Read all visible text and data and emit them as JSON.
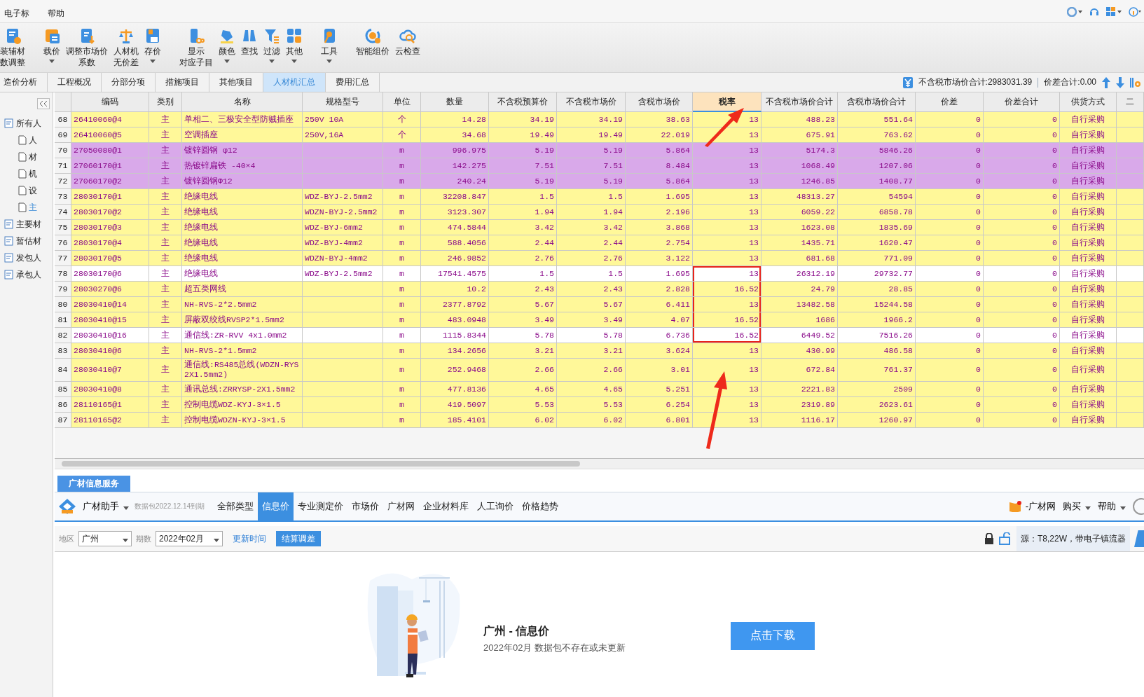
{
  "menu": [
    "电子标",
    "帮助"
  ],
  "toolbar": [
    {
      "lines": [
        "装辅材",
        "数调整"
      ],
      "has_menu": false
    },
    {
      "lines": [
        "载价"
      ],
      "has_menu": true
    },
    {
      "lines": [
        "调整市场价",
        "系数"
      ],
      "has_menu": false
    },
    {
      "lines": [
        "人材机",
        "无价差"
      ],
      "has_menu": false
    },
    {
      "lines": [
        "存价"
      ],
      "has_menu": true
    },
    {
      "lines": [
        "显示",
        "对应子目"
      ],
      "has_menu": false
    },
    {
      "lines": [
        "颜色"
      ],
      "has_menu": true
    },
    {
      "lines": [
        "查找"
      ],
      "has_menu": false
    },
    {
      "lines": [
        "过滤"
      ],
      "has_menu": true
    },
    {
      "lines": [
        "其他"
      ],
      "has_menu": true
    },
    {
      "lines": [
        "工具"
      ],
      "has_menu": true
    },
    {
      "lines": [
        "智能组价"
      ],
      "has_menu": false
    },
    {
      "lines": [
        "云检查"
      ],
      "has_menu": false
    }
  ],
  "tabs": [
    {
      "label": "造价分析",
      "selected": false
    },
    {
      "label": "工程概况",
      "selected": false
    },
    {
      "label": "分部分项",
      "selected": false
    },
    {
      "label": "措施项目",
      "selected": false
    },
    {
      "label": "其他项目",
      "selected": false
    },
    {
      "label": "人材机汇总",
      "selected": true
    },
    {
      "label": "费用汇总",
      "selected": false
    }
  ],
  "summary": {
    "total": "不含税市场价合计:2983031.39",
    "diff": "价差合计:0.00"
  },
  "tree": [
    {
      "label": "所有人",
      "selected": false,
      "expanded": true,
      "children": [
        {
          "label": "人",
          "selected": false
        },
        {
          "label": "材",
          "selected": false
        },
        {
          "label": "机",
          "selected": false
        },
        {
          "label": "设",
          "selected": false
        },
        {
          "label": "主",
          "selected": true
        }
      ]
    },
    {
      "label": "主要材",
      "selected": false
    },
    {
      "label": "暂估材",
      "selected": false
    },
    {
      "label": "发包人",
      "selected": false
    },
    {
      "label": "承包人",
      "selected": false
    }
  ],
  "table": {
    "columns": [
      {
        "selected": false
      },
      {
        "label": "编码",
        "selected": false
      },
      {
        "label": "类别",
        "selected": false
      },
      {
        "label": "名称",
        "selected": false
      },
      {
        "label": "规格型号",
        "selected": false
      },
      {
        "label": "单位",
        "selected": false
      },
      {
        "label": "数量",
        "selected": false
      },
      {
        "label": "不含税预算价",
        "selected": false
      },
      {
        "label": "不含税市场价",
        "selected": false
      },
      {
        "label": "含税市场价",
        "selected": false
      },
      {
        "label": "税率",
        "selected": true
      },
      {
        "label": "不含税市场价合计",
        "selected": false
      },
      {
        "label": "含税市场价合计",
        "selected": false
      },
      {
        "label": "价差",
        "selected": false
      },
      {
        "label": "价差合计",
        "selected": false
      },
      {
        "label": "供货方式",
        "selected": false
      },
      {
        "label": "二",
        "selected": false
      }
    ],
    "rows": [
      {
        "color": "#fff899",
        "marked": false,
        "no": "68",
        "code": "26410060@4",
        "type": "主",
        "name": "单相二、三极安全型防贼插座",
        "spec": "250V 10A",
        "unit": "个",
        "qty": "14.28",
        "budget": "34.19",
        "market": "34.19",
        "market_tax": "38.63",
        "rate": "13",
        "total": "488.23",
        "total_tax": "551.64",
        "diff": "0",
        "diff_total": "0",
        "supply": "自行采购"
      },
      {
        "color": "#fff899",
        "marked": false,
        "no": "69",
        "code": "26410060@5",
        "type": "主",
        "name": "空调插座",
        "spec": "250V,16A",
        "unit": "个",
        "qty": "34.68",
        "budget": "19.49",
        "market": "19.49",
        "market_tax": "22.019",
        "rate": "13",
        "total": "675.91",
        "total_tax": "763.62",
        "diff": "0",
        "diff_total": "0",
        "supply": "自行采购"
      },
      {
        "color": "#d9a9ea",
        "marked": false,
        "no": "70",
        "code": "27050080@1",
        "type": "主",
        "name": "镀锌圆钢 φ12",
        "unit": "m",
        "qty": "996.975",
        "budget": "5.19",
        "market": "5.19",
        "market_tax": "5.864",
        "rate": "13",
        "total": "5174.3",
        "total_tax": "5846.26",
        "diff": "0",
        "diff_total": "0",
        "supply": "自行采购"
      },
      {
        "color": "#d9a9ea",
        "marked": false,
        "no": "71",
        "code": "27060170@1",
        "type": "主",
        "name": "热镀锌扁铁 -40×4",
        "unit": "m",
        "qty": "142.275",
        "budget": "7.51",
        "market": "7.51",
        "market_tax": "8.484",
        "rate": "13",
        "total": "1068.49",
        "total_tax": "1207.06",
        "diff": "0",
        "diff_total": "0",
        "supply": "自行采购"
      },
      {
        "color": "#d9a9ea",
        "marked": false,
        "no": "72",
        "code": "27060170@2",
        "type": "主",
        "name": "镀锌圆钢Φ12",
        "unit": "m",
        "qty": "240.24",
        "budget": "5.19",
        "market": "5.19",
        "market_tax": "5.864",
        "rate": "13",
        "total": "1246.85",
        "total_tax": "1408.77",
        "diff": "0",
        "diff_total": "0",
        "supply": "自行采购"
      },
      {
        "color": "#fff899",
        "marked": false,
        "no": "73",
        "code": "28030170@1",
        "type": "主",
        "name": "绝缘电线",
        "spec": "WDZ-BYJ-2.5mm2",
        "unit": "m",
        "qty": "32208.847",
        "budget": "1.5",
        "market": "1.5",
        "market_tax": "1.695",
        "rate": "13",
        "total": "48313.27",
        "total_tax": "54594",
        "diff": "0",
        "diff_total": "0",
        "supply": "自行采购"
      },
      {
        "color": "#fff899",
        "marked": false,
        "no": "74",
        "code": "28030170@2",
        "type": "主",
        "name": "绝缘电线",
        "spec": "WDZN-BYJ-2.5mm2",
        "unit": "m",
        "qty": "3123.307",
        "budget": "1.94",
        "market": "1.94",
        "market_tax": "2.196",
        "rate": "13",
        "total": "6059.22",
        "total_tax": "6858.78",
        "diff": "0",
        "diff_total": "0",
        "supply": "自行采购"
      },
      {
        "color": "#fff899",
        "marked": false,
        "no": "75",
        "code": "28030170@3",
        "type": "主",
        "name": "绝缘电线",
        "spec": "WDZ-BYJ-6mm2",
        "unit": "m",
        "qty": "474.5844",
        "budget": "3.42",
        "market": "3.42",
        "market_tax": "3.868",
        "rate": "13",
        "total": "1623.08",
        "total_tax": "1835.69",
        "diff": "0",
        "diff_total": "0",
        "supply": "自行采购"
      },
      {
        "color": "#fff899",
        "marked": false,
        "no": "76",
        "code": "28030170@4",
        "type": "主",
        "name": "绝缘电线",
        "spec": "WDZ-BYJ-4mm2",
        "unit": "m",
        "qty": "588.4056",
        "budget": "2.44",
        "market": "2.44",
        "market_tax": "2.754",
        "rate": "13",
        "total": "1435.71",
        "total_tax": "1620.47",
        "diff": "0",
        "diff_total": "0",
        "supply": "自行采购"
      },
      {
        "color": "#fff899",
        "marked": false,
        "no": "77",
        "code": "28030170@5",
        "type": "主",
        "name": "绝缘电线",
        "spec": "WDZN-BYJ-4mm2",
        "unit": "m",
        "qty": "246.9852",
        "budget": "2.76",
        "market": "2.76",
        "market_tax": "3.122",
        "rate": "13",
        "total": "681.68",
        "total_tax": "771.09",
        "diff": "0",
        "diff_total": "0",
        "supply": "自行采购"
      },
      {
        "color": "#ffffff",
        "marked": true,
        "no": "78",
        "code": "28030170@6",
        "type": "主",
        "name": "绝缘电线",
        "spec": "WDZ-BYJ-2.5mm2",
        "unit": "m",
        "qty": "17541.4575",
        "budget": "1.5",
        "market": "1.5",
        "market_tax": "1.695",
        "rate": "13",
        "total": "26312.19",
        "total_tax": "29732.77",
        "diff": "0",
        "diff_total": "0",
        "supply": "自行采购"
      },
      {
        "color": "#fff899",
        "marked": true,
        "no": "79",
        "code": "28030270@6",
        "type": "主",
        "name": "超五类网线",
        "unit": "m",
        "qty": "10.2",
        "budget": "2.43",
        "market": "2.43",
        "market_tax": "2.828",
        "rate": "16.52",
        "total": "24.79",
        "total_tax": "28.85",
        "diff": "0",
        "diff_total": "0",
        "supply": "自行采购"
      },
      {
        "color": "#fff899",
        "marked": true,
        "no": "80",
        "code": "28030410@14",
        "type": "主",
        "name": "NH-RVS-2*2.5mm2",
        "unit": "m",
        "qty": "2377.8792",
        "budget": "5.67",
        "market": "5.67",
        "market_tax": "6.411",
        "rate": "13",
        "total": "13482.58",
        "total_tax": "15244.58",
        "diff": "0",
        "diff_total": "0",
        "supply": "自行采购"
      },
      {
        "color": "#fff899",
        "marked": true,
        "no": "81",
        "code": "28030410@15",
        "type": "主",
        "name": "屏蔽双绞线RVSP2*1.5mm2",
        "unit": "m",
        "qty": "483.0948",
        "budget": "3.49",
        "market": "3.49",
        "market_tax": "4.07",
        "rate": "16.52",
        "total": "1686",
        "total_tax": "1966.2",
        "diff": "0",
        "diff_total": "0",
        "supply": "自行采购"
      },
      {
        "color": "#ffffff",
        "marked": true,
        "no": "82",
        "code": "28030410@16",
        "type": "主",
        "name": "通信线:ZR-RVV 4x1.0mm2",
        "unit": "m",
        "qty": "1115.8344",
        "budget": "5.78",
        "market": "5.78",
        "market_tax": "6.736",
        "rate": "16.52",
        "total": "6449.52",
        "total_tax": "7516.26",
        "diff": "0",
        "diff_total": "0",
        "supply": "自行采购"
      },
      {
        "color": "#fff899",
        "marked": false,
        "no": "83",
        "code": "28030410@6",
        "type": "主",
        "name": "NH-RVS-2*1.5mm2",
        "unit": "m",
        "qty": "134.2656",
        "budget": "3.21",
        "market": "3.21",
        "market_tax": "3.624",
        "rate": "13",
        "total": "430.99",
        "total_tax": "486.58",
        "diff": "0",
        "diff_total": "0",
        "supply": "自行采购"
      },
      {
        "color": "#fff899",
        "marked": false,
        "no": "84",
        "code": "28030410@7",
        "type": "主",
        "name": "通信线:RS485总线(WDZN-RYS 2X1.5mm2)",
        "unit": "m",
        "qty": "252.9468",
        "budget": "2.66",
        "market": "2.66",
        "market_tax": "3.01",
        "rate": "13",
        "total": "672.84",
        "total_tax": "761.37",
        "diff": "0",
        "diff_total": "0",
        "supply": "自行采购"
      },
      {
        "color": "#fff899",
        "marked": false,
        "no": "85",
        "code": "28030410@8",
        "type": "主",
        "name": "通讯总线:ZRRYSP-2X1.5mm2",
        "unit": "m",
        "qty": "477.8136",
        "budget": "4.65",
        "market": "4.65",
        "market_tax": "5.251",
        "rate": "13",
        "total": "2221.83",
        "total_tax": "2509",
        "diff": "0",
        "diff_total": "0",
        "supply": "自行采购"
      },
      {
        "color": "#fff899",
        "marked": false,
        "no": "86",
        "code": "28110165@1",
        "type": "主",
        "name": "控制电缆WDZ-KYJ-3×1.5",
        "unit": "m",
        "qty": "419.5097",
        "budget": "5.53",
        "market": "5.53",
        "market_tax": "6.254",
        "rate": "13",
        "total": "2319.89",
        "total_tax": "2623.61",
        "diff": "0",
        "diff_total": "0",
        "supply": "自行采购"
      },
      {
        "color": "#fff899",
        "marked": false,
        "no": "87",
        "code": "28110165@2",
        "type": "主",
        "name": "控制电缆WDZN-KYJ-3×1.5",
        "unit": "m",
        "qty": "185.4101",
        "budget": "6.02",
        "market": "6.02",
        "market_tax": "6.801",
        "rate": "13",
        "total": "1116.17",
        "total_tax": "1260.97",
        "diff": "0",
        "diff_total": "0",
        "supply": "自行采购"
      }
    ]
  },
  "info_panel": {
    "tab": "广材信息服务",
    "brand": "广材助手",
    "expiry": "数据包2022.12.14到期",
    "nav": [
      {
        "label": "全部类型",
        "selected": false
      },
      {
        "label": "信息价",
        "selected": true
      },
      {
        "label": "专业测定价",
        "selected": false
      },
      {
        "label": "市场价",
        "selected": false
      },
      {
        "label": "广材网",
        "selected": false
      },
      {
        "label": "企业材料库",
        "selected": false
      },
      {
        "label": "人工询价",
        "selected": false
      },
      {
        "label": "价格趋势",
        "selected": false
      }
    ],
    "promo": "-广材网",
    "buy": "购买",
    "help": "帮助",
    "region_label": "地区",
    "region": "广州",
    "period_label": "期数",
    "period": "2022年02月",
    "update_link": "更新时间",
    "settle_button": "结算调差",
    "source": "源：T8,22W，带电子镇流器",
    "empty_title": "广州 - 信息价",
    "empty_text": "2022年02月 数据包不存在或未更新",
    "download_button": "点击下载"
  }
}
